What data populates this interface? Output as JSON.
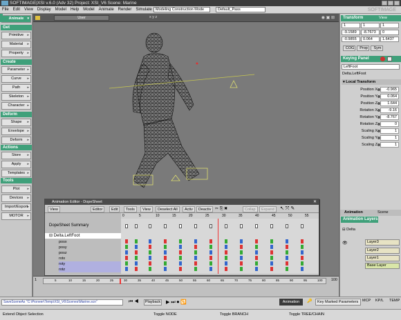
{
  "window": {
    "title": "SOFTIMAGE|XSI v.6.0 (Adv 32) Project: XSI_V6      Scene: Marine",
    "watermark": "SOFTIMAGE"
  },
  "menu": [
    "File",
    "Edit",
    "View",
    "Display",
    "Model",
    "Help",
    "Model",
    "Animate",
    "Render",
    "Simulate",
    "Hair"
  ],
  "toolbar": {
    "mode_combo": "Modeling Construction Mode",
    "pass_combo": "Default_Pass"
  },
  "left_panel": {
    "mode": "Animate",
    "sections": [
      {
        "title": "Get",
        "items": [
          "Primitive",
          "Material",
          "Property"
        ]
      },
      {
        "title": "Create",
        "items": [
          "Parameter",
          "Curve",
          "Path",
          "Skeleton",
          "Character"
        ]
      },
      {
        "title": "Deform",
        "items": [
          "Shape",
          "Envelope",
          "Deform"
        ]
      },
      {
        "title": "Actions",
        "items": [
          "Store",
          "Apply",
          "Templates"
        ]
      },
      {
        "title": "Tools",
        "items": [
          "Plot",
          "Devices",
          "Import/Export",
          "MOTOR"
        ]
      }
    ]
  },
  "viewport": {
    "camera_label": "User",
    "axis_label": "x y z"
  },
  "transform_panel": {
    "title": "Transform",
    "view": "View",
    "rows": [
      [
        "1",
        "1",
        "1"
      ],
      [
        "-9.1589",
        "-8.7673",
        "0"
      ],
      [
        "-0.9855",
        "0.064",
        "1.6437"
      ]
    ],
    "buttons": [
      "COG",
      "Prop",
      "Sym"
    ]
  },
  "keying_panel": {
    "title": "Keying Panel",
    "object": "LeftFoot",
    "path": "Delta.LeftFoot",
    "local_transform": "Local Transform",
    "params": [
      {
        "label": "Position X",
        "value": "-0.965"
      },
      {
        "label": "Position Y",
        "value": "0.064"
      },
      {
        "label": "Position Z",
        "value": "1.644"
      },
      {
        "label": "Rotation X",
        "value": "-9.16"
      },
      {
        "label": "Rotation Y",
        "value": "-8.767"
      },
      {
        "label": "Rotation Z",
        "value": "0"
      },
      {
        "label": "Scaling X",
        "value": "1"
      },
      {
        "label": "Scaling Y",
        "value": "1"
      },
      {
        "label": "Scaling Z",
        "value": "1"
      }
    ]
  },
  "layers_panel": {
    "tabs": [
      "Animation",
      "Scene"
    ],
    "title": "Animation Layers",
    "root": "Delta",
    "layers": [
      "Layer3",
      "Layer2",
      "Layer1",
      "Base Layer"
    ]
  },
  "dopesheet": {
    "title": "Animation Editor - DopeSheet",
    "tools": [
      "View",
      "Editor",
      "Edit",
      "Tools",
      "View",
      "Deselect All",
      "Activ",
      "Deactiv",
      "Collap",
      "Expand"
    ],
    "summary_label": "DopeSheet Summary",
    "root": "Delta.LeftFoot",
    "tracks": [
      "posx",
      "posy",
      "posz",
      "rotx",
      "roty",
      "rotz"
    ],
    "ruler": [
      "0",
      "5",
      "10",
      "15",
      "20",
      "25",
      "30",
      "35",
      "40",
      "45",
      "50",
      "55"
    ]
  },
  "timeline": {
    "start": "1",
    "end": "100",
    "current": "28",
    "ticks": [
      "5",
      "10",
      "15",
      "20",
      "25",
      "30",
      "35",
      "40",
      "45",
      "50",
      "55",
      "60",
      "65",
      "70",
      "75",
      "80",
      "85",
      "90",
      "95",
      "100"
    ]
  },
  "bottom_bar": {
    "command": "SaveSceneAs \"C:\\Pioneer\\Temp\\XSI_V6\\Scenes\\Marine.scn\"",
    "playback": "Playback",
    "animation": "Animation",
    "key_marked": "Key Marked Parameters",
    "right_buttons": [
      "MCP",
      "KP/L",
      "TEMP"
    ]
  },
  "status": {
    "left": "Extend Object Selection",
    "mid1": "Toggle NODE",
    "mid2": "Toggle BRANCH",
    "mid3": "Toggle TREE/CHAIN"
  }
}
